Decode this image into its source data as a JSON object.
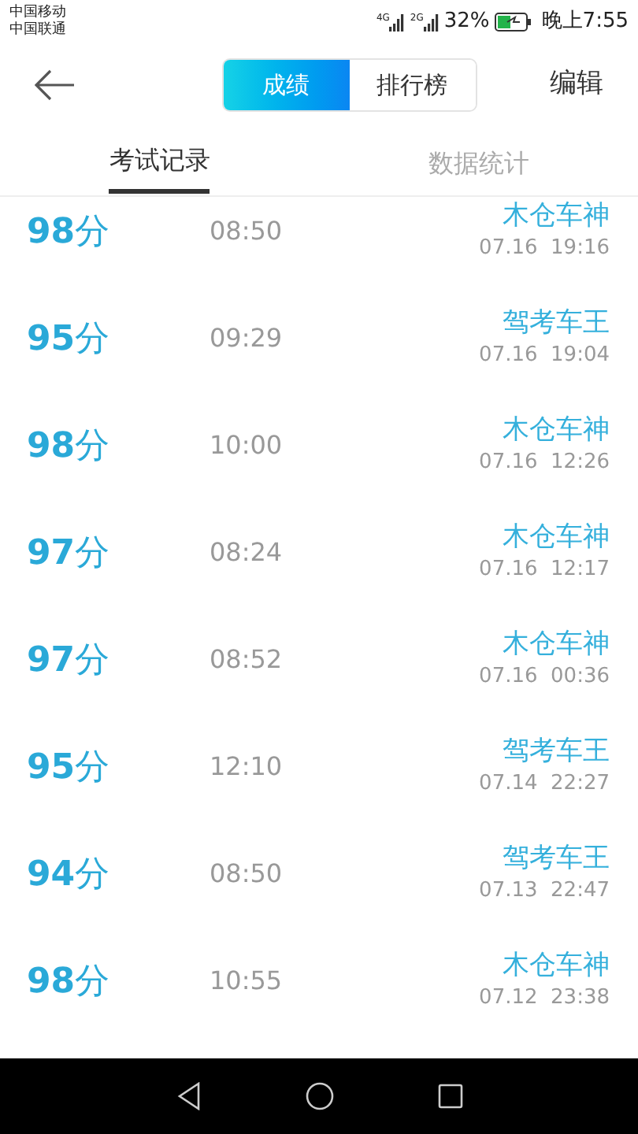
{
  "status_bar": {
    "carriers": [
      "中国移动",
      "中国联通"
    ],
    "signal_labels": [
      "4G",
      "2G"
    ],
    "battery": "32%",
    "time": "晚上7:55"
  },
  "header": {
    "segments": [
      {
        "label": "成绩",
        "selected": true
      },
      {
        "label": "排行榜",
        "selected": false
      }
    ],
    "action": "编辑"
  },
  "tabs": [
    {
      "label": "考试记录",
      "selected": true
    },
    {
      "label": "数据统计",
      "selected": false
    }
  ],
  "records": [
    {
      "score": "**98**分",
      "duration": "08:50",
      "title": "木仓车神",
      "date": "07.16  19:16"
    },
    {
      "score": "**95**分",
      "duration": "09:29",
      "title": "驾考车王",
      "date": "07.16  19:04"
    },
    {
      "score": "**98**分",
      "duration": "10:00",
      "title": "木仓车神",
      "date": "07.16  12:26"
    },
    {
      "score": "**97**分",
      "duration": "08:24",
      "title": "木仓车神",
      "date": "07.16  12:17"
    },
    {
      "score": "**97**分",
      "duration": "08:52",
      "title": "木仓车神",
      "date": "07.16  00:36"
    },
    {
      "score": "**95**分",
      "duration": "12:10",
      "title": "驾考车王",
      "date": "07.14  22:27"
    },
    {
      "score": "**94**分",
      "duration": "08:50",
      "title": "驾考车王",
      "date": "07.13  22:47"
    },
    {
      "score": "**98**分",
      "duration": "10:55",
      "title": "木仓车神",
      "date": "07.12  23:38"
    }
  ]
}
